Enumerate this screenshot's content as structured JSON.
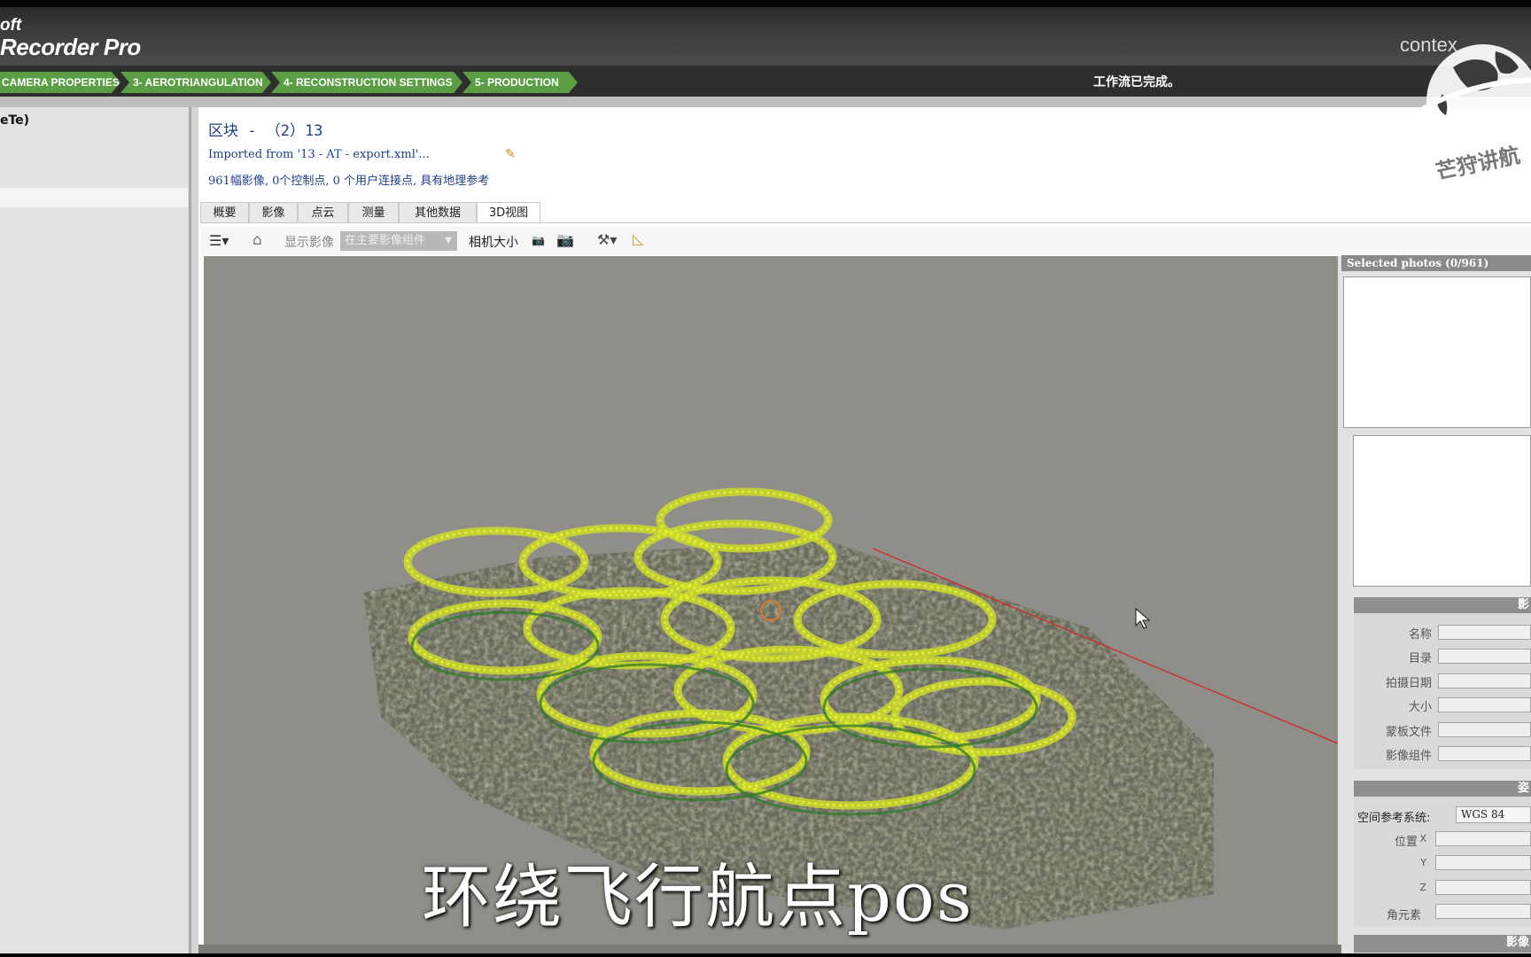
{
  "app": {
    "brand_line1": "oft",
    "brand_line2": "Recorder Pro",
    "context_label": "contex"
  },
  "workflow": {
    "steps": [
      "CAMERA PROPERTIES",
      "3- AEROTRIANGULATION",
      "4- RECONSTRUCTION SETTINGS",
      "5- PRODUCTION"
    ],
    "status": "工作流已完成。",
    "accent_color": "#5b9e43"
  },
  "left": {
    "label": "eTe)"
  },
  "block": {
    "title": "区块 - （2）13",
    "imported": "Imported from '13 - AT - export.xml'...",
    "stats": "961幅影像, 0个控制点, 0 个用户连接点, 具有地理参考"
  },
  "tabs": [
    "概要",
    "影像",
    "点云",
    "测量",
    "其他数据",
    "3D视图"
  ],
  "active_tab": "3D视图",
  "toolbar": {
    "show_images_label": "显示影像",
    "show_images_value": "在主要影像组件",
    "camera_size_label": "相机大小"
  },
  "right": {
    "selected_photos": "Selected photos (0/961)",
    "image_group_head": "影",
    "props": [
      "名称",
      "目录",
      "拍摄日期",
      "大小",
      "蒙板文件",
      "影像组件"
    ],
    "pose_group_head": "姿",
    "srs_label": "空间参考系统:",
    "srs_value": "WGS 84",
    "position_label": "位置",
    "axes": [
      "X",
      "Y",
      "Z"
    ],
    "orientation_label": "角元素",
    "bottom_head": "影像"
  },
  "subtitle": "环绕飞行航点pos",
  "logo_text": "芒狩讲航"
}
